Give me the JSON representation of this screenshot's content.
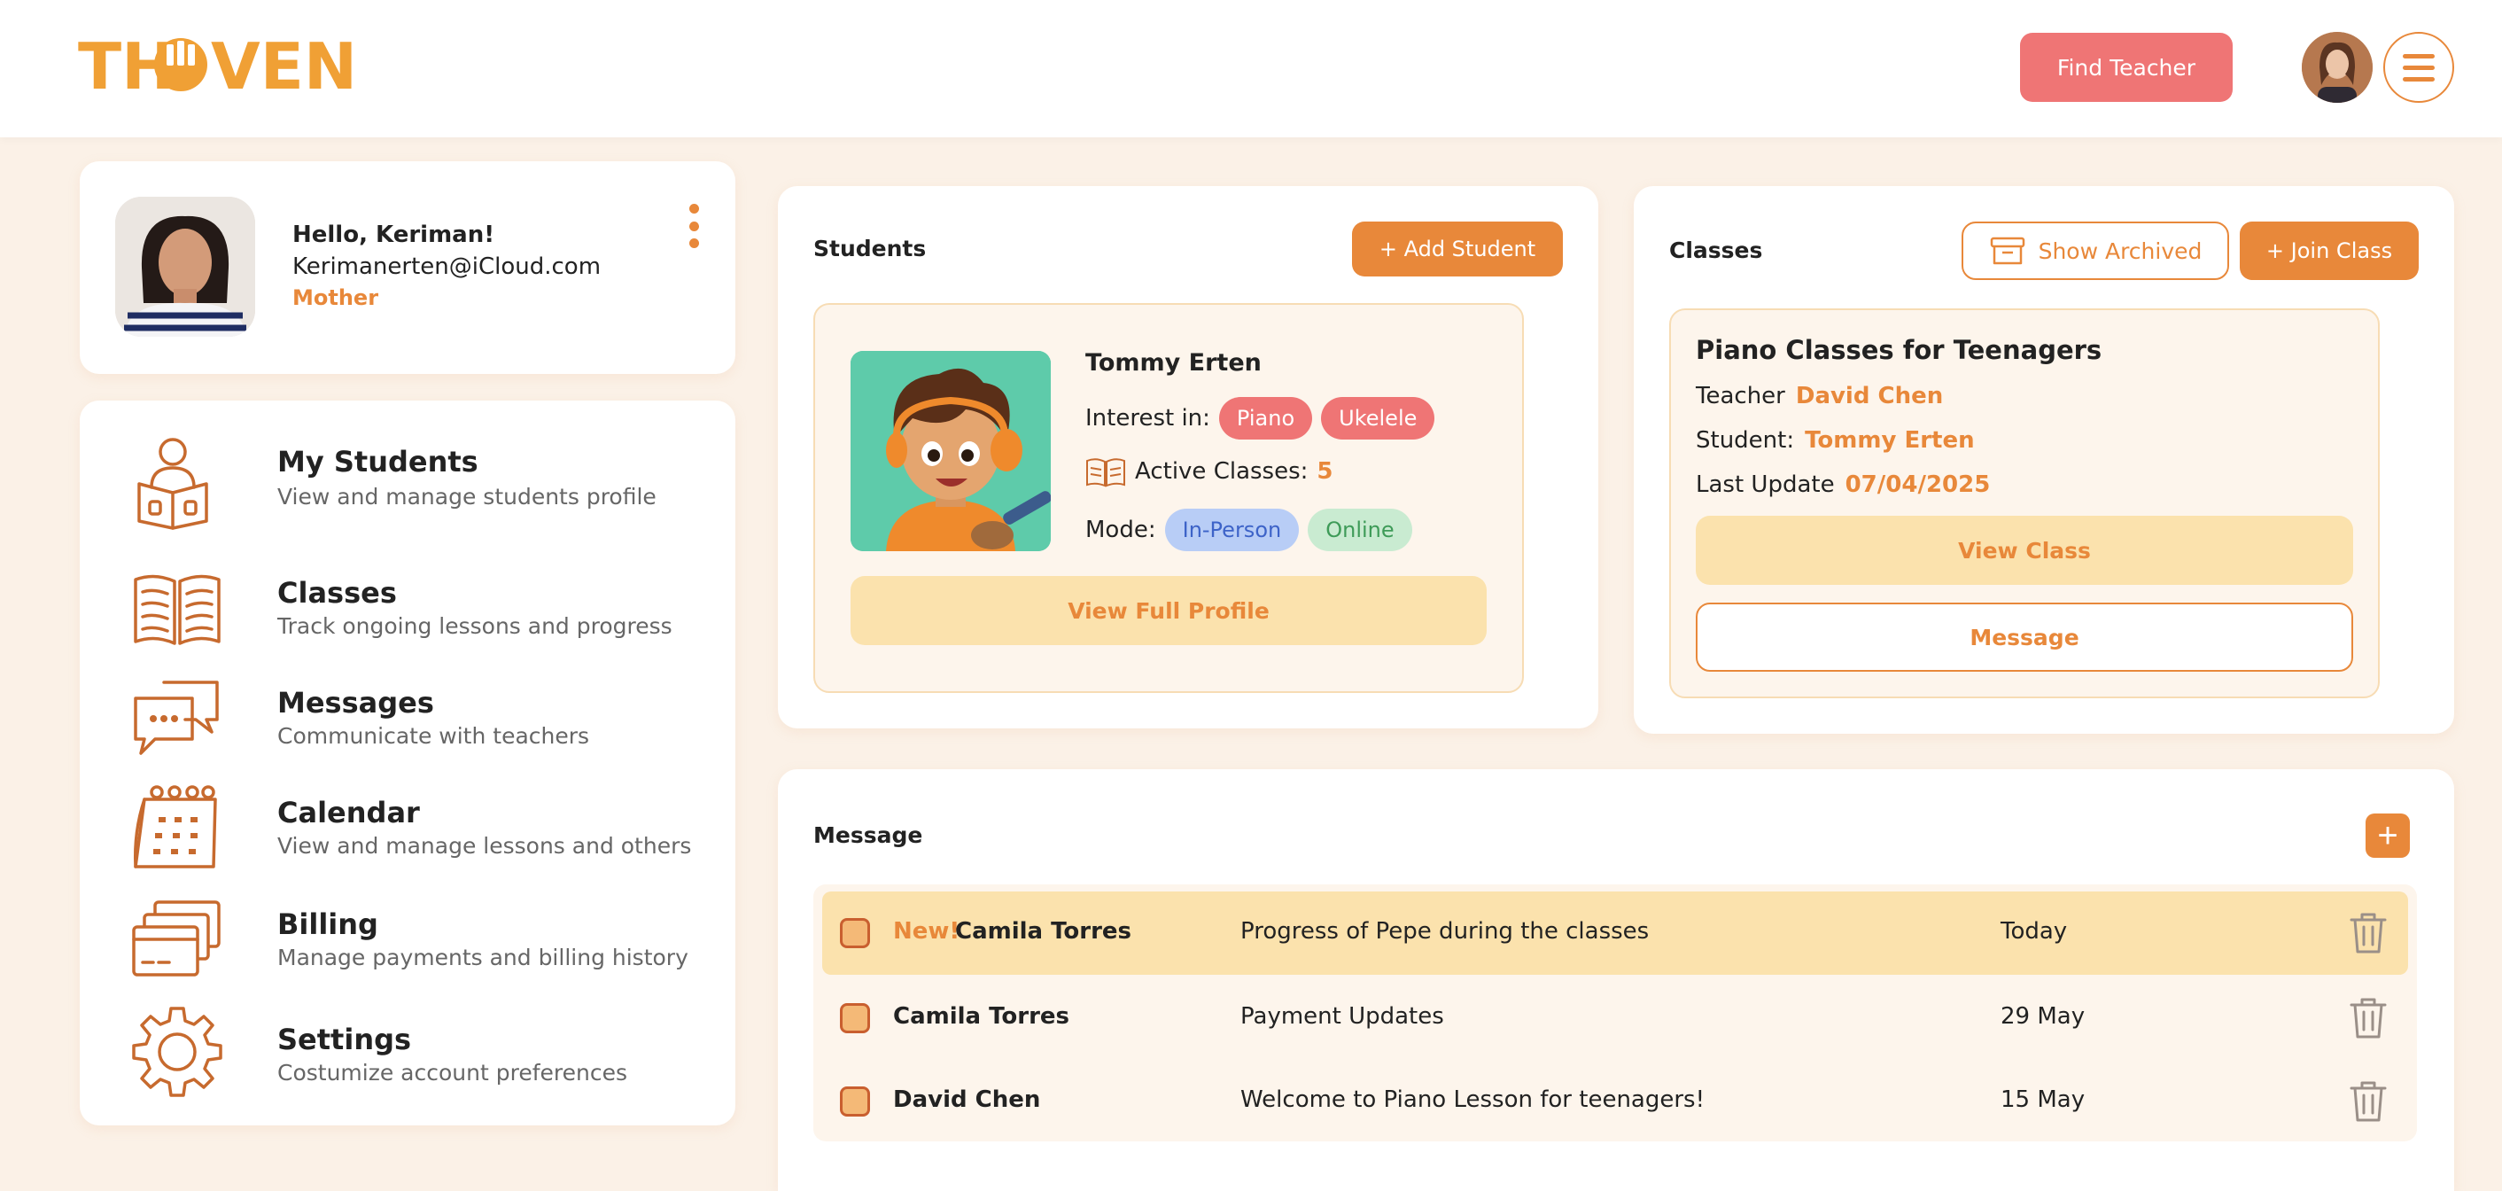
{
  "app": {
    "logo_text": "THOVEN",
    "find_teacher_label": "Find Teacher"
  },
  "profile": {
    "greeting": "Hello, Keriman!",
    "email": "Kerimanerten@iCloud.com",
    "role": "Mother"
  },
  "nav": {
    "items": [
      {
        "title": "My Students",
        "desc": "View and manage students profile",
        "icon": "student-reading-icon"
      },
      {
        "title": "Classes",
        "desc": "Track ongoing lessons and progress",
        "icon": "open-book-icon"
      },
      {
        "title": "Messages",
        "desc": "Communicate with teachers",
        "icon": "chat-bubbles-icon"
      },
      {
        "title": "Calendar",
        "desc": "View and manage lessons and others",
        "icon": "calendar-icon"
      },
      {
        "title": "Billing",
        "desc": "Manage payments and billing history",
        "icon": "credit-cards-icon"
      },
      {
        "title": "Settings",
        "desc": "Costumize account preferences",
        "icon": "gear-icon"
      }
    ]
  },
  "students": {
    "title": "Students",
    "add_label": "+ Add Student",
    "card": {
      "name": "Tommy Erten",
      "interest_label": "Interest in:",
      "interests": [
        "Piano",
        "Ukelele"
      ],
      "active_label": "Active Classes:",
      "active_count": "5",
      "mode_label": "Mode:",
      "modes": [
        "In-Person",
        "Online"
      ],
      "view_profile_label": "View Full Profile"
    }
  },
  "classes": {
    "title": "Classes",
    "show_archived_label": "Show Archived",
    "join_label": "+ Join Class",
    "card": {
      "title": "Piano Classes for Teenagers",
      "teacher_label": "Teacher",
      "teacher": "David Chen",
      "student_label": "Student:",
      "student": "Tommy Erten",
      "update_label": "Last Update",
      "update": "07/04/2025",
      "view_label": "View Class",
      "message_label": "Message"
    }
  },
  "messages": {
    "title": "Message",
    "add_symbol": "+",
    "rows": [
      {
        "tag": "New!",
        "from": "Camila Torres",
        "subject": "Progress of Pepe during the classes",
        "date": "Today"
      },
      {
        "tag": "",
        "from": "Camila Torres",
        "subject": "Payment Updates",
        "date": "29 May"
      },
      {
        "tag": "",
        "from": "David Chen",
        "subject": "Welcome to Piano Lesson for teenagers!",
        "date": "15 May"
      }
    ]
  },
  "colors": {
    "accent": "#e8883a",
    "logo": "#f0a035",
    "cta_red": "#ef7575",
    "soft_button": "#fbe2ad",
    "page_bg": "#fbf1e7"
  }
}
